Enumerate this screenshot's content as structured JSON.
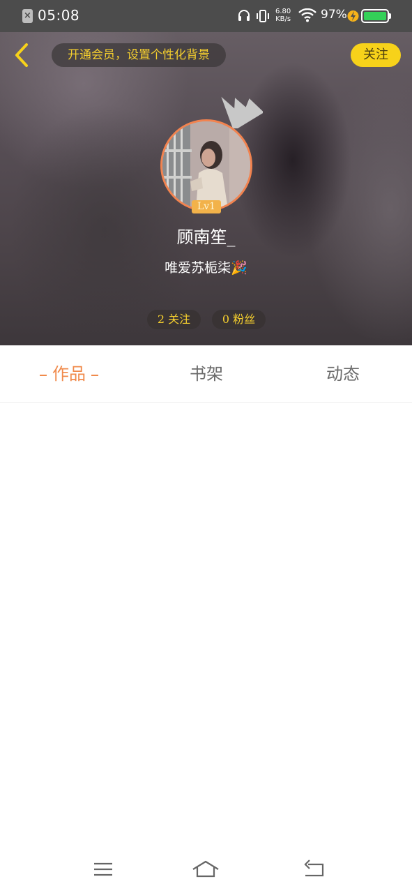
{
  "status_bar": {
    "time": "05:08",
    "sim_icon": "sim-error-icon",
    "net_speed_value": "6.80",
    "net_speed_unit": "KB/s",
    "battery_percent": "97%",
    "battery_color": "#34d058"
  },
  "header": {
    "vip_prompt": "开通会员，设置个性化背景",
    "follow_label": "关注",
    "accent_color": "#f7d21a"
  },
  "profile": {
    "level": "Lv1",
    "username": "顾南笙_",
    "signature": "唯爱苏栀柒🎉",
    "following": "2 关注",
    "fans": "0 粉丝"
  },
  "tabs": [
    {
      "label": "作品",
      "active": true
    },
    {
      "label": "书架",
      "active": false
    },
    {
      "label": "动态",
      "active": false
    }
  ],
  "tab_active_color": "#f08a4b",
  "nav": {
    "menu_icon": "menu-icon",
    "home_icon": "home-icon",
    "back_icon": "back-icon"
  }
}
